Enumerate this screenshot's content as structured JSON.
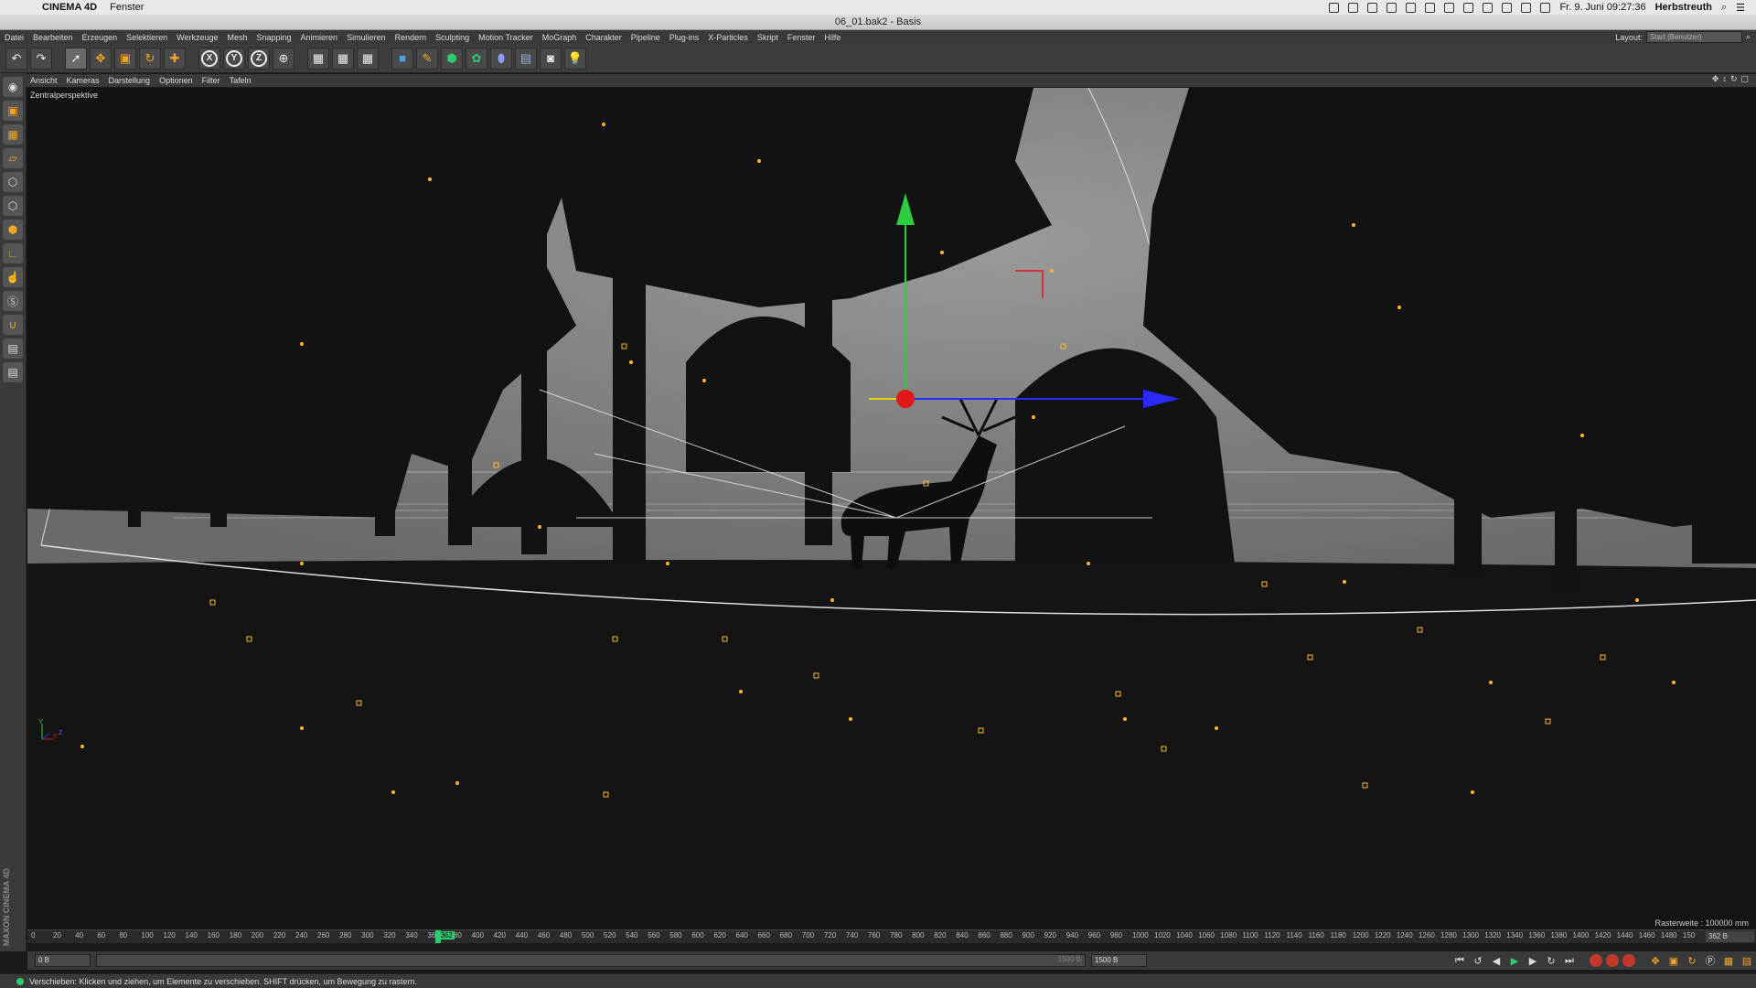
{
  "macos_menubar": {
    "app_name": "CINEMA 4D",
    "menus": [
      "Fenster"
    ],
    "clock": "Fr. 9. Juni  09:27:36",
    "user": "Herbstreuth"
  },
  "window": {
    "title": "06_01.bak2 - Basis"
  },
  "main_menu": {
    "items": [
      "Datei",
      "Bearbeiten",
      "Erzeugen",
      "Selektieren",
      "Werkzeuge",
      "Mesh",
      "Snapping",
      "Animieren",
      "Simulieren",
      "Rendern",
      "Sculpting",
      "Motion Tracker",
      "MoGraph",
      "Charakter",
      "Pipeline",
      "Plug-ins",
      "X-Particles",
      "Skript",
      "Fenster",
      "Hilfe"
    ],
    "layout_label": "Layout:",
    "layout_value": "Start (Benutzer)"
  },
  "toolbar": {
    "axis_x": "X",
    "axis_y": "Y",
    "axis_z": "Z",
    "icons": [
      "undo-icon",
      "redo-icon",
      "select-icon",
      "move-icon",
      "scale-icon",
      "rotate-icon",
      "add-icon",
      "axis-x-icon",
      "axis-y-icon",
      "axis-z-icon",
      "coordinate-system-icon",
      "render-view-icon",
      "render-picture-queue-icon",
      "render-settings-icon",
      "cube-icon",
      "pen-spline-icon",
      "subdivision-icon",
      "mograph-cloner-icon",
      "deformer-icon",
      "floor-grid-icon",
      "camera-icon",
      "light-icon"
    ]
  },
  "left_palette": {
    "icons": [
      "make-editable-icon",
      "model-mode-icon",
      "texture-mode-icon",
      "workplane-icon",
      "points-mode-icon",
      "edges-mode-icon",
      "polygons-mode-icon",
      "axis-mode-icon",
      "tweak-mode-icon",
      "snapping-icon",
      "magnet-icon",
      "lock-workplane-icon",
      "solo-icon"
    ],
    "brand": "MAXON CINEMA 4D"
  },
  "viewport_menu": {
    "items": [
      "Ansicht",
      "Kameras",
      "Darstellung",
      "Optionen",
      "Filter",
      "Tafeln"
    ],
    "nav_icons": [
      "move-view-icon",
      "zoom-view-icon",
      "rotate-view-icon",
      "maximize-view-icon"
    ]
  },
  "viewport": {
    "label": "Zentralperspektive",
    "grid_info": "Rasterweite : 100000 mm",
    "axis_gizmo": {
      "y": "Y",
      "x": "X",
      "z": "Z"
    }
  },
  "timeline": {
    "ticks": [
      "0",
      "20",
      "40",
      "60",
      "80",
      "100",
      "120",
      "140",
      "160",
      "180",
      "200",
      "220",
      "240",
      "260",
      "280",
      "300",
      "320",
      "340",
      "360",
      "380",
      "400",
      "420",
      "440",
      "460",
      "480",
      "500",
      "520",
      "540",
      "560",
      "580",
      "600",
      "620",
      "640",
      "660",
      "680",
      "700",
      "720",
      "740",
      "760",
      "780",
      "800",
      "820",
      "840",
      "860",
      "880",
      "900",
      "920",
      "940",
      "960",
      "980",
      "1000",
      "1020",
      "1040",
      "1060",
      "1080",
      "1100",
      "1120",
      "1140",
      "1160",
      "1180",
      "1200",
      "1220",
      "1240",
      "1260",
      "1280",
      "1300",
      "1320",
      "1340",
      "1360",
      "1380",
      "1400",
      "1420",
      "1440",
      "1460",
      "1480",
      "150"
    ],
    "current_frame": "362",
    "current_frame_fraction": 0.2413,
    "end_field": "362 B"
  },
  "transport": {
    "start_field": "0 B",
    "range_field": "1500 B",
    "end_field": "1500 B",
    "icons": [
      "goto-start-icon",
      "prev-key-icon",
      "prev-frame-icon",
      "play-icon",
      "next-frame-icon",
      "next-key-icon",
      "goto-end-icon",
      "record-icon",
      "autokey-icon",
      "keyframe-selection-icon",
      "position-key-icon",
      "scale-key-icon",
      "rotation-key-icon",
      "param-key-icon",
      "pla-key-icon",
      "timeline-icon"
    ]
  },
  "statusbar": {
    "text": "Verschieben: Klicken und ziehen, um Elemente zu verschieben. SHIFT drücken, um Bewegung zu rastern."
  }
}
